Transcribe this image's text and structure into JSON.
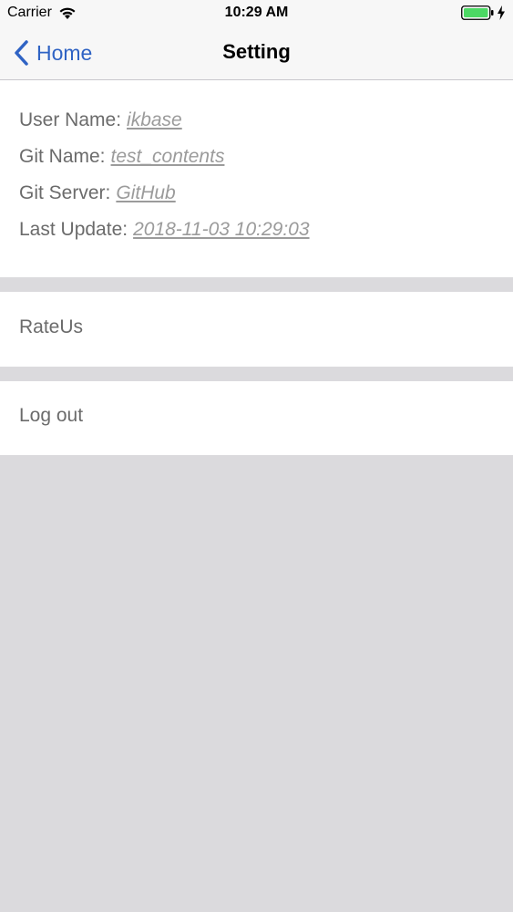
{
  "status_bar": {
    "carrier": "Carrier",
    "time": "10:29 AM"
  },
  "nav": {
    "back_label": "Home",
    "title": "Setting"
  },
  "info": {
    "user_name_label": "User Name:",
    "user_name_value": "ikbase",
    "git_name_label": "Git Name:",
    "git_name_value": "test_contents",
    "git_server_label": "Git Server:",
    "git_server_value": "GitHub",
    "last_update_label": "Last Update:",
    "last_update_value": "2018-11-03 10:29:03"
  },
  "actions": {
    "rate_label": "RateUs",
    "logout_label": "Log out"
  },
  "colors": {
    "accent": "#2f63c4",
    "background": "#dbdadd",
    "battery": "#4cd964"
  },
  "icons": {
    "wifi": "wifi-icon",
    "battery": "battery-icon",
    "charging": "bolt-icon",
    "back": "back-chevron-icon"
  }
}
